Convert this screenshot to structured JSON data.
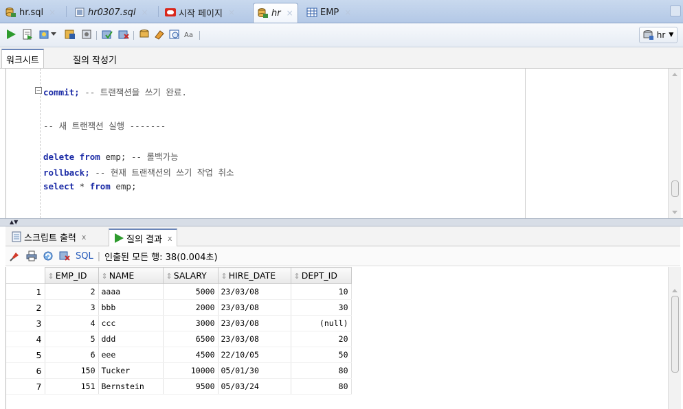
{
  "tabs": [
    {
      "label": "hr.sql",
      "icon": "db-connection-icon"
    },
    {
      "label": "hr0307.sql",
      "icon": "sql-file-icon"
    },
    {
      "label": "시작 페이지",
      "icon": "oracle-start-icon"
    },
    {
      "label": "hr",
      "icon": "db-connection-icon"
    },
    {
      "label": "EMP",
      "icon": "table-icon"
    }
  ],
  "connection": {
    "label": "hr"
  },
  "worksheet_tabs": [
    "워크시트",
    "질의 작성기"
  ],
  "editor": {
    "line1_kw": "commit;",
    "line1_cm": " -- 트랜잭션을 쓰기 완료.",
    "line2_cm": "-- 새 트랜잭션 실행 -------",
    "line3_kw": "delete from",
    "line3_txt": " emp;",
    "line3_cm": " -- 롤백가능",
    "line4_kw": "rollback;",
    "line4_cm": " -- 현재 트랜잭션의 쓰기 작업 취소",
    "line5_kw1": "select",
    "line5_txt1": " * ",
    "line5_kw2": "from",
    "line5_txt2": " emp;"
  },
  "output_tabs": [
    {
      "label": "스크립트 출력",
      "close": "x"
    },
    {
      "label": "질의 결과",
      "close": "x"
    }
  ],
  "output_toolbar": {
    "sql_label": "SQL",
    "status": "인출된 모든 행: 38(0.004초)"
  },
  "grid": {
    "columns": [
      "EMP_ID",
      "NAME",
      "SALARY",
      "HIRE_DATE",
      "DEPT_ID"
    ],
    "rows": [
      [
        "1",
        "2",
        "aaaa",
        "5000",
        "23/03/08",
        "10"
      ],
      [
        "2",
        "3",
        "bbb",
        "2000",
        "23/03/08",
        "30"
      ],
      [
        "3",
        "4",
        "ccc",
        "3000",
        "23/03/08",
        "(null)"
      ],
      [
        "4",
        "5",
        "ddd",
        "6500",
        "23/03/08",
        "20"
      ],
      [
        "5",
        "6",
        "eee",
        "4500",
        "22/10/05",
        "50"
      ],
      [
        "6",
        "150",
        "Tucker",
        "10000",
        "05/01/30",
        "80"
      ],
      [
        "7",
        "151",
        "Bernstein",
        "9500",
        "05/03/24",
        "80"
      ]
    ]
  }
}
